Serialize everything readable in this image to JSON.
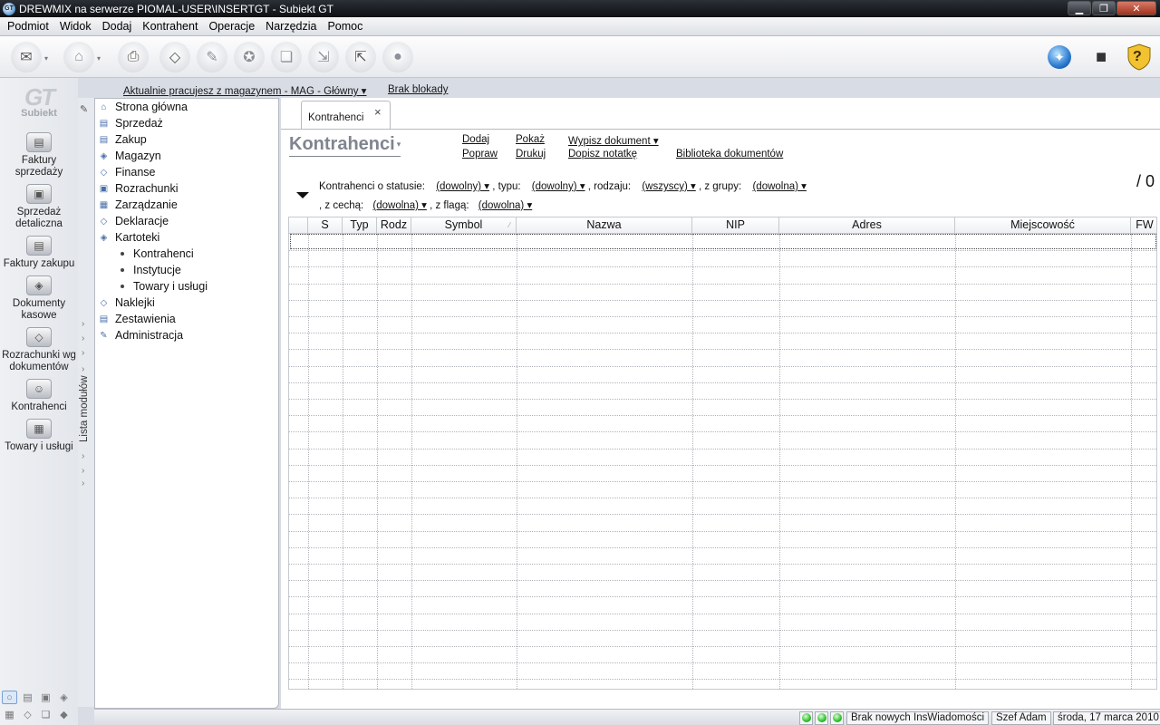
{
  "window": {
    "title": "DREWMIX na serwerze PIOMAL-USER\\INSERTGT - Subiekt GT",
    "app_icon_text": "GT",
    "controls": {
      "minimize": "▁",
      "maximize": "❐",
      "close": "✕"
    }
  },
  "menu": [
    "Podmiot",
    "Widok",
    "Dodaj",
    "Kontrahent",
    "Operacje",
    "Narzędzia",
    "Pomoc"
  ],
  "toolbar": {
    "left_icons": [
      "envelope-icon",
      "folder-icon",
      "printer-icon",
      "eraser-icon",
      "note-icon",
      "stamp-icon",
      "copy-icon",
      "export-icon",
      "import-icon",
      "disk-icon"
    ],
    "right_icons": [
      "globe-icon",
      "cube-icon",
      "help-icon"
    ],
    "dropdown_glyph": "▾",
    "glyphs": {
      "envelope": "✉",
      "folder": "⌂",
      "printer": "⎙",
      "eraser": "◇",
      "note": "✎",
      "stamp": "✪",
      "copy": "❏",
      "export": "⇲",
      "import": "⇱",
      "disk": "●",
      "globe": "✦",
      "cube": "■",
      "help": "?"
    }
  },
  "logo": {
    "mark": "GT",
    "name": "Subiekt"
  },
  "left_rail": {
    "items": [
      {
        "label1": "Faktury",
        "label2": "sprzedaży",
        "icon": "invoice-stack-icon",
        "glyph": "▤"
      },
      {
        "label1": "Sprzedaż",
        "label2": "detaliczna",
        "icon": "cash-register-icon",
        "glyph": "▣"
      },
      {
        "label1": "Faktury zakupu",
        "label2": "",
        "icon": "purchase-invoice-icon",
        "glyph": "▤"
      },
      {
        "label1": "Dokumenty",
        "label2": "kasowe",
        "icon": "cash-docs-icon",
        "glyph": "◈"
      },
      {
        "label1": "Rozrachunki wg",
        "label2": "dokumentów",
        "icon": "settlement-icon",
        "glyph": "◇"
      },
      {
        "label1": "Kontrahenci",
        "label2": "",
        "icon": "contractor-icon",
        "glyph": "☺"
      },
      {
        "label1": "Towary i usługi",
        "label2": "",
        "icon": "goods-icon",
        "glyph": "▦"
      }
    ],
    "bottom_row1": [
      "○",
      "▤",
      "▣",
      "◈"
    ],
    "bottom_row2": [
      "▦",
      "◇",
      "❏",
      "◆"
    ]
  },
  "module_strip": {
    "label": "Lista modułów",
    "pin_glyph": "✎",
    "chevron": "›"
  },
  "info": {
    "warehouse": "Aktualnie pracujesz z magazynem - MAG - Główny ▾",
    "lock": "Brak blokady"
  },
  "modules": {
    "items": [
      {
        "label": "Strona główna",
        "icon": "home-icon",
        "glyph": "⌂"
      },
      {
        "label": "Sprzedaż",
        "icon": "sale-icon",
        "glyph": "▤"
      },
      {
        "label": "Zakup",
        "icon": "purchase-icon",
        "glyph": "▤"
      },
      {
        "label": "Magazyn",
        "icon": "warehouse-icon",
        "glyph": "◈"
      },
      {
        "label": "Finanse",
        "icon": "finance-icon",
        "glyph": "◇"
      },
      {
        "label": "Rozrachunki",
        "icon": "settlements-icon",
        "glyph": "▣"
      },
      {
        "label": "Zarządzanie",
        "icon": "management-icon",
        "glyph": "▦"
      },
      {
        "label": "Deklaracje",
        "icon": "declarations-icon",
        "glyph": "◇"
      },
      {
        "label": "Kartoteki",
        "icon": "records-icon",
        "glyph": "◈"
      }
    ],
    "sub_items": [
      "Kontrahenci",
      "Instytucje",
      "Towary i usługi"
    ],
    "items_after": [
      {
        "label": "Naklejki",
        "icon": "labels-icon",
        "glyph": "◇"
      },
      {
        "label": "Zestawienia",
        "icon": "reports-icon",
        "glyph": "▤"
      },
      {
        "label": "Administracja",
        "icon": "admin-icon",
        "glyph": "✎"
      }
    ]
  },
  "main": {
    "tab": {
      "label": "Kontrahenci",
      "close": "×"
    },
    "title": "Kontrahenci",
    "title_dropdown": "▾",
    "actions": {
      "add": "Dodaj",
      "edit": "Popraw",
      "show": "Pokaż",
      "print": "Drukuj",
      "write_doc": "Wypisz dokument ▾",
      "add_note": "Dopisz notatkę",
      "doc_library": "Biblioteka dokumentów"
    },
    "filters": {
      "status_label": "Kontrahenci o statusie:",
      "status_value": "(dowolny) ▾",
      "type_label": ", typu:",
      "type_value": "(dowolny) ▾",
      "kind_label": ", rodzaju:",
      "kind_value": "(wszyscy) ▾",
      "group_label": ", z grupy:",
      "group_value": "(dowolna) ▾",
      "feature_label": ", z cechą:",
      "feature_value": "(dowolna) ▾",
      "flag_label": ", z flagą:",
      "flag_value": "(dowolna) ▾"
    },
    "count": "/ 0",
    "columns": [
      "",
      "S",
      "Typ",
      "Rodz",
      "Symbol",
      "Nazwa",
      "NIP",
      "Adres",
      "Miejscowość",
      "FW"
    ],
    "rows": []
  },
  "status": {
    "messages": "Brak nowych InsWiadomości",
    "user": "Szef Adam",
    "date": "środa, 17 marca 2010"
  }
}
